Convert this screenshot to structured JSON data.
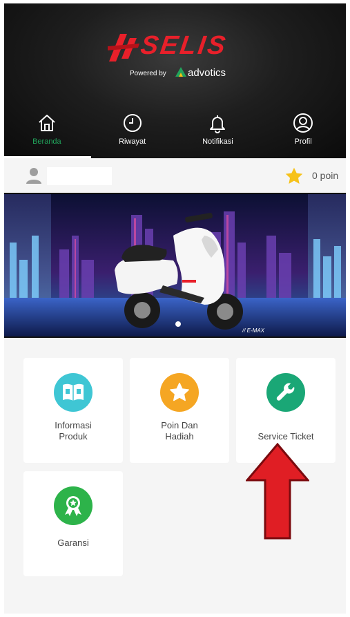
{
  "brand": {
    "name": "SELIS",
    "powered_by": "Powered by",
    "partner": "advotics",
    "brand_color": "#e8202a",
    "partner_color": "#21a35b"
  },
  "nav": {
    "items": [
      {
        "label": "Beranda",
        "icon": "home-icon",
        "active": true
      },
      {
        "label": "Riwayat",
        "icon": "clock-icon",
        "active": false
      },
      {
        "label": "Notifikasi",
        "icon": "bell-icon",
        "active": false
      },
      {
        "label": "Profil",
        "icon": "user-circle-icon",
        "active": false
      }
    ],
    "active_color": "#21a35b"
  },
  "user": {
    "name": "",
    "points": "0 poin",
    "points_icon": "star-icon"
  },
  "banner": {
    "model": "// E-MAX",
    "pager": {
      "count": 1,
      "active": 0
    }
  },
  "menu": [
    {
      "label_line1": "Informasi",
      "label_line2": "Produk",
      "icon": "book-icon",
      "color": "#3fc6d4"
    },
    {
      "label_line1": "Poin Dan",
      "label_line2": "Hadiah",
      "icon": "star-badge-icon",
      "color": "#f5a623"
    },
    {
      "label_line1": "Service Ticket",
      "label_line2": "",
      "icon": "wrench-icon",
      "color": "#1aa776"
    },
    {
      "label_line1": "Garansi",
      "label_line2": "",
      "icon": "award-ribbon-icon",
      "color": "#2db34a"
    }
  ],
  "annotation": {
    "icon": "red-arrow-up-icon",
    "color": "#e01e24"
  }
}
